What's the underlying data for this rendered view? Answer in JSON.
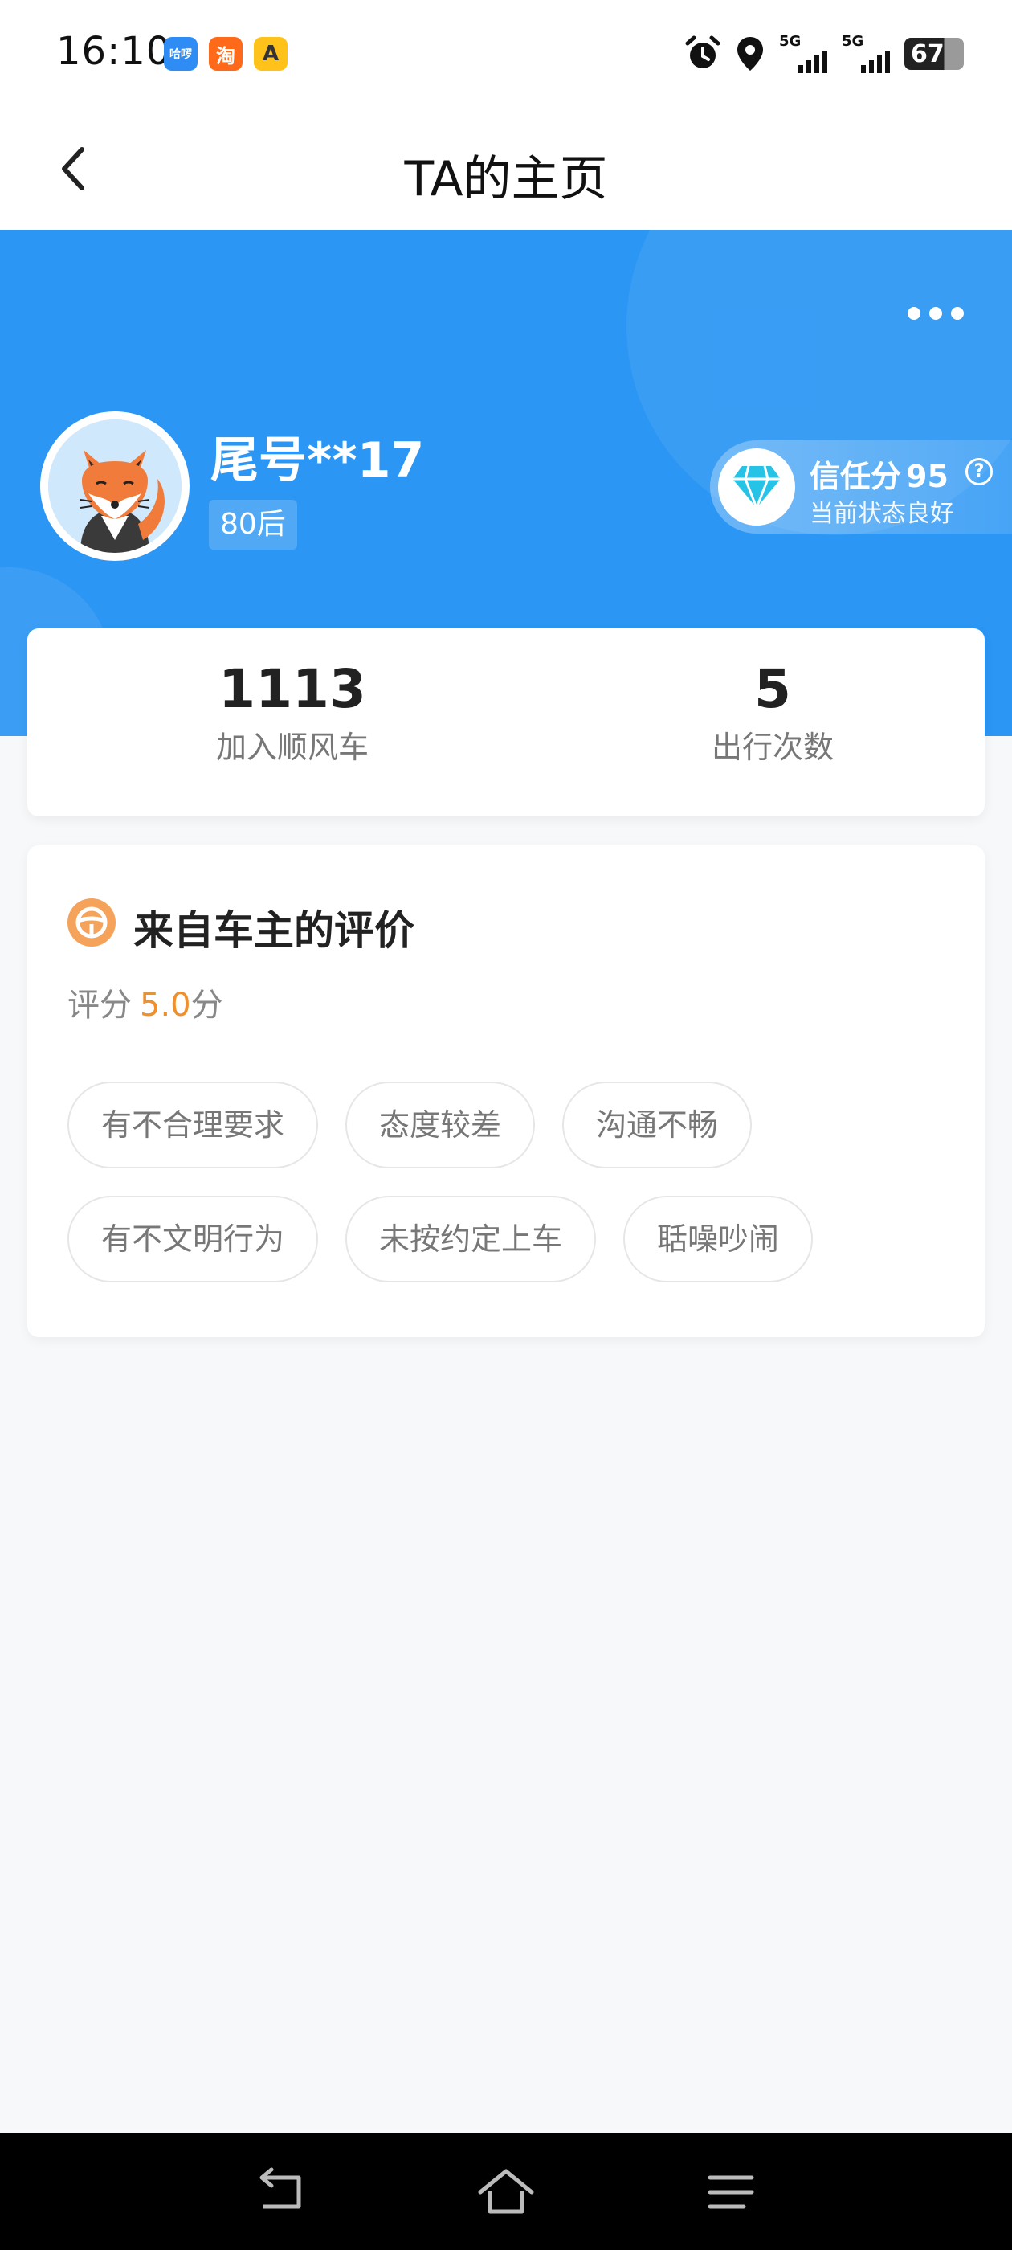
{
  "status_bar": {
    "time": "16:10",
    "app_badges": [
      {
        "name": "haluo-app-icon",
        "label": "哈啰"
      },
      {
        "name": "taobao-app-icon",
        "label": "淘"
      },
      {
        "name": "gaode-app-icon",
        "label": "A"
      }
    ],
    "signal_1_label": "5G",
    "signal_2_label": "5G",
    "battery": "67"
  },
  "nav": {
    "title": "TA的主页"
  },
  "profile": {
    "name": "尾号**17",
    "age_tag": "80后",
    "trust_label": "信任分",
    "trust_score": "95",
    "trust_help": "?",
    "trust_status": "当前状态良好"
  },
  "stats": [
    {
      "value": "1113",
      "label": "加入顺风车"
    },
    {
      "value": "5",
      "label": "出行次数"
    }
  ],
  "rating": {
    "title": "来自车主的评价",
    "score_label": "评分",
    "score_value": "5.0",
    "score_unit": "分",
    "tags_row1": [
      "有不合理要求",
      "态度较差",
      "沟通不畅"
    ],
    "tags_row2": [
      "有不文明行为",
      "未按约定上车",
      "聒噪吵闹"
    ]
  },
  "colors": {
    "header_blue": "#2b96f4",
    "score_orange": "#f0902a",
    "gem_cyan": "#27c3e6"
  },
  "icons": {
    "back": "chevron-left-icon",
    "more": "more-dots-icon",
    "trust": "diamond-icon",
    "rating": "steering-wheel-icon"
  }
}
